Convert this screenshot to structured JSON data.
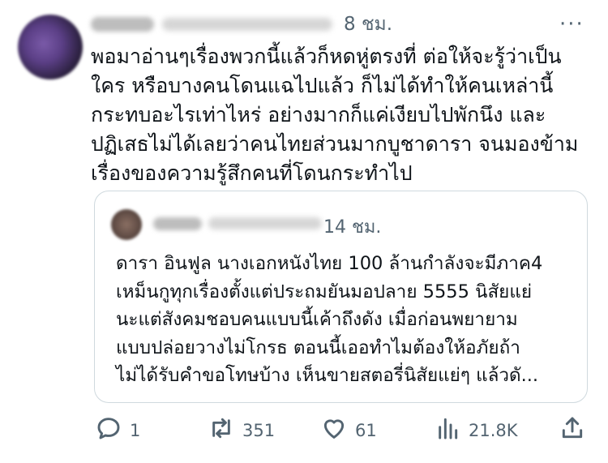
{
  "post": {
    "time": "8 ชม.",
    "more": "···",
    "lines": [
      "พอมาอ่านๆเรื่องพวกนี้แล้วก็หดหู่ตรงที่ ต่อให้จะรู้ว่าเป็น",
      "ใคร หรือบางคนโดนแฉไปแล้ว ก็ไม่ได้ทำให้คนเหล่านี้",
      "กระทบอะไรเท่าไหร่ อย่างมากก็แค่เงียบไปพักนึง และ",
      "ปฏิเสธไม่ได้เลยว่าคนไทยส่วนมากบูชาดารา จนมองข้าม",
      "เรื่องของความรู้สึกคนที่โดนกระทำไป"
    ]
  },
  "quote": {
    "time": "14 ชม.",
    "lines": [
      "ดารา อินฟูล นางเอกหนังไทย 100 ล้านกำลังจะมีภาค4",
      "เหม็นกูทุกเรื่องตั้งแต่ประถมยันมอปลาย 5555 นิสัยแย่",
      "นะแต่สังคมชอบคนแบบนี้เค้าถึงดัง  เมื่อก่อนพยายาม",
      "แบบปล่อยวางไม่โกรธ ตอนนี้เออทำไมต้องให้อภัยถ้า",
      "ไม่ได้รับคำขอโทษบ้าง เห็นขายสตอรี่นิสัยแย่ๆ แล้วดั..."
    ]
  },
  "actions": {
    "replies": "1",
    "reposts": "351",
    "likes": "61",
    "views": "21.8K"
  },
  "icons": [
    "reply-icon",
    "repost-icon",
    "like-icon",
    "views-icon",
    "share-icon"
  ],
  "colors": {
    "text": "#0f1419",
    "muted": "#536471",
    "border": "#cfd9de"
  }
}
